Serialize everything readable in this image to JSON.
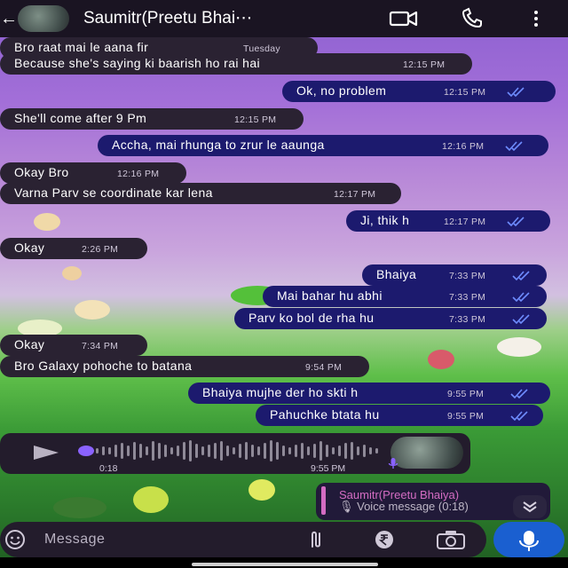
{
  "header": {
    "contact_name": "Saumitr(Preetu Bhai⋯",
    "icons": [
      "back-arrow-icon",
      "video-call-icon",
      "voice-call-icon",
      "more-options-icon"
    ]
  },
  "messages": [
    {
      "direction": "in",
      "text": "Bro raat mai le aana fir",
      "time": "Tuesday",
      "read": false
    },
    {
      "direction": "in",
      "text": "Because she's saying ki baarish ho rai hai",
      "time": "12:15 PM",
      "read": false
    },
    {
      "direction": "out",
      "text": "Ok, no problem",
      "time": "12:15 PM",
      "read": true
    },
    {
      "direction": "in",
      "text": "She'll come after 9 Pm",
      "time": "12:15 PM",
      "read": false
    },
    {
      "direction": "out",
      "text": "Accha, mai rhunga to zrur le aaunga",
      "time": "12:16 PM",
      "read": true
    },
    {
      "direction": "in",
      "text": "Okay Bro",
      "time": "12:16 PM",
      "read": false
    },
    {
      "direction": "in",
      "text": "Varna Parv se coordinate kar lena",
      "time": "12:17 PM",
      "read": false
    },
    {
      "direction": "out",
      "text": "Ji, thik h",
      "time": "12:17 PM",
      "read": true
    },
    {
      "direction": "in",
      "text": "Okay",
      "time": "2:26 PM",
      "read": false
    },
    {
      "direction": "out",
      "text": "Bhaiya",
      "time": "7:33 PM",
      "read": true
    },
    {
      "direction": "out",
      "text": "Mai bahar hu abhi",
      "time": "7:33 PM",
      "read": true
    },
    {
      "direction": "out",
      "text": "Parv ko bol de rha hu",
      "time": "7:33 PM",
      "read": true
    },
    {
      "direction": "in",
      "text": "Okay",
      "time": "7:34 PM",
      "read": false
    },
    {
      "direction": "in",
      "text": "Bro Galaxy pohoche to batana",
      "time": "9:54 PM",
      "read": false
    },
    {
      "direction": "out",
      "text": "Bhaiya mujhe der ho skti h",
      "time": "9:55 PM",
      "read": true
    },
    {
      "direction": "out",
      "text": "Pahuchke btata hu",
      "time": "9:55 PM",
      "read": true
    }
  ],
  "voice_message": {
    "duration": "0:18",
    "time": "9:55 PM"
  },
  "reply_preview": {
    "name": "Saumitr(Preetu Bhaiya)",
    "subtitle": "🎙 Voice message (0:18)"
  },
  "input": {
    "placeholder": "Message"
  },
  "colors": {
    "header_bg": "#1a1422",
    "incoming_bubble": "#2a2232",
    "outgoing_bubble": "#1c1a6e",
    "read_ticks": "#6e8cff",
    "reply_accent": "#d36cc2",
    "mic_button": "#1a5fd0"
  }
}
